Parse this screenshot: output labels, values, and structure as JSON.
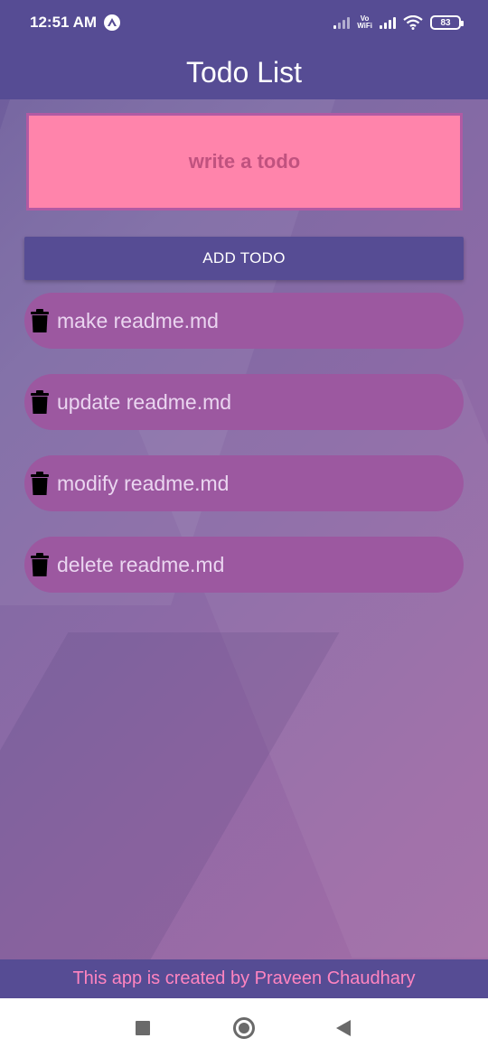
{
  "status_bar": {
    "time": "12:51 AM",
    "vowifi_line1": "Vo",
    "vowifi_line2": "WiFi",
    "battery": "83"
  },
  "app_bar": {
    "title": "Todo List"
  },
  "input": {
    "placeholder": "write a todo",
    "value": ""
  },
  "add_button": {
    "label": "ADD TODO"
  },
  "todos": [
    {
      "text": "make readme.md"
    },
    {
      "text": "update readme.md"
    },
    {
      "text": "modify readme.md"
    },
    {
      "text": "delete readme.md"
    }
  ],
  "footer": {
    "text": "This app is created by Praveen Chaudhary"
  },
  "icons": {
    "trash": "trash-icon",
    "nav_recent": "square-icon",
    "nav_home": "circle-icon",
    "nav_back": "triangle-back-icon"
  },
  "colors": {
    "bar": "#564c94",
    "input_bg": "#ff84ab",
    "item_bg": "#9c58a0",
    "footer_text": "#ff84c0"
  }
}
